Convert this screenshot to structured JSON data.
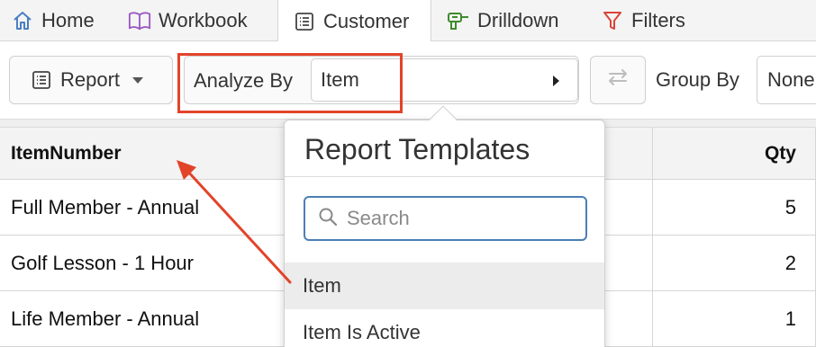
{
  "tabs": [
    {
      "label": "Home",
      "icon": "home-icon"
    },
    {
      "label": "Workbook",
      "icon": "book-icon"
    },
    {
      "label": "Customer",
      "icon": "list-icon",
      "active": true
    },
    {
      "label": "Drilldown",
      "icon": "drill-icon"
    },
    {
      "label": "Filters",
      "icon": "filter-icon"
    }
  ],
  "toolbar": {
    "report_label": "Report",
    "analyze_label": "Analyze By",
    "analyze_value": "Item",
    "group_by_label": "Group By",
    "group_by_value": "None"
  },
  "table": {
    "columns": [
      "ItemNumber",
      "Qty"
    ],
    "rows": [
      {
        "item": "Full Member - Annual",
        "qty": "5"
      },
      {
        "item": "Golf Lesson - 1 Hour",
        "qty": "2"
      },
      {
        "item": "Life Member - Annual",
        "qty": "1"
      }
    ]
  },
  "popover": {
    "title": "Report Templates",
    "search_placeholder": "Search",
    "options": [
      "Item",
      "Item Is Active"
    ]
  },
  "colors": {
    "highlight": "#e2442a",
    "search_border": "#4a7fb5",
    "home_icon": "#4a7fc4",
    "workbook_icon": "#9b59c4",
    "drilldown_icon": "#3f8a2e",
    "filter_icon": "#d9453a"
  }
}
